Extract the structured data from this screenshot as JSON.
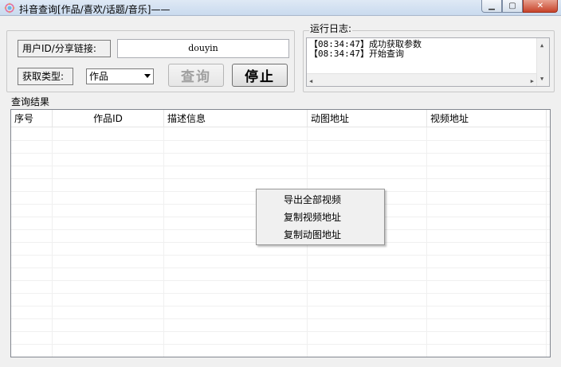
{
  "window": {
    "title": "抖音查询[作品/喜欢/话题/音乐]——",
    "min_symbol": "▁",
    "max_symbol": "▢",
    "close_symbol": "✕"
  },
  "query": {
    "user_label": "用户ID/分享链接:",
    "user_value": "douyin",
    "type_label": "获取类型:",
    "type_selected": "作品",
    "query_button": "查询",
    "stop_button": "停止"
  },
  "log": {
    "label": "运行日志:",
    "lines": [
      "【08:34:47】成功获取参数",
      "【08:34:47】开始查询"
    ]
  },
  "results": {
    "label": "查询结果",
    "columns": [
      "序号",
      "作品ID",
      "描述信息",
      "动图地址",
      "视频地址"
    ]
  },
  "context_menu": {
    "items": [
      "导出全部视频",
      "复制视频地址",
      "复制动图地址"
    ]
  },
  "colors": {
    "titlebar": "#c9daee",
    "close": "#c7432a"
  }
}
